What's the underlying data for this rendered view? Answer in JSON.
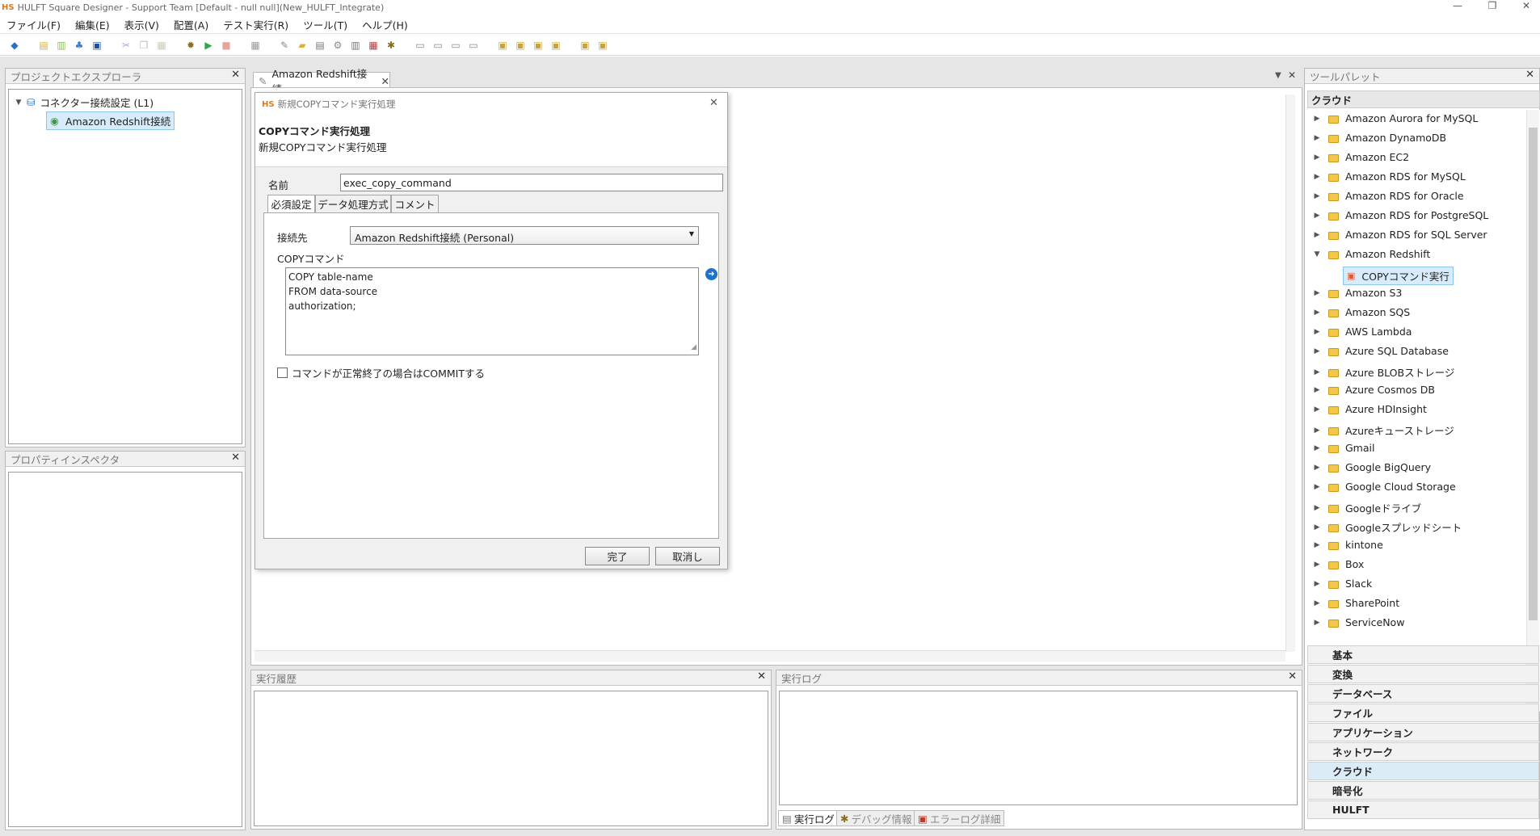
{
  "window": {
    "logo": "HS",
    "title": "HULFT Square Designer - Support Team [Default - null null](New_HULFT_Integrate)",
    "minimize": "—",
    "restore": "❐",
    "close": "✕"
  },
  "menu": [
    "ファイル(F)",
    "編集(E)",
    "表示(V)",
    "配置(A)",
    "テスト実行(R)",
    "ツール(T)",
    "ヘルプ(H)"
  ],
  "project_explorer": {
    "title": "プロジェクトエクスプローラ",
    "root": "コネクター接続設定 (L1)",
    "child": "Amazon Redshift接続"
  },
  "property_inspector": {
    "title": "プロパティインスペクタ"
  },
  "editor": {
    "tab_label": "Amazon Redshift接続"
  },
  "dialog": {
    "logo": "HS",
    "title": "新規COPYコマンド実行処理",
    "heading": "COPYコマンド実行処理",
    "subheading": "新規COPYコマンド実行処理",
    "name_label": "名前",
    "name_value": "exec_copy_command",
    "tabs": [
      "必須設定",
      "データ処理方式",
      "コメント"
    ],
    "connection_label": "接続先",
    "connection_value": "Amazon Redshift接続 (Personal)",
    "command_label": "COPYコマンド",
    "command_lines": [
      "COPY table-name",
      "FROM data-source",
      "authorization;"
    ],
    "commit_label": "コマンドが正常終了の場合はCOMMITする",
    "commit_checked": false,
    "ok_button": "完了",
    "cancel_button": "取消し"
  },
  "exec_history": {
    "title": "実行履歴"
  },
  "exec_log": {
    "title": "実行ログ",
    "tabs": [
      "実行ログ",
      "デバッグ情報",
      "エラーログ詳細"
    ]
  },
  "tool_palette": {
    "title": "ツールパレット",
    "section": "クラウド",
    "items": [
      "Amazon Aurora for MySQL",
      "Amazon DynamoDB",
      "Amazon EC2",
      "Amazon RDS for MySQL",
      "Amazon RDS for Oracle",
      "Amazon RDS for PostgreSQL",
      "Amazon RDS for SQL Server",
      "Amazon Redshift",
      "Amazon S3",
      "Amazon SQS",
      "AWS Lambda",
      "Azure SQL Database",
      "Azure BLOBストレージ",
      "Azure Cosmos DB",
      "Azure HDInsight",
      "Azureキューストレージ",
      "Gmail",
      "Google BigQuery",
      "Google Cloud Storage",
      "Googleドライブ",
      "Googleスプレッドシート",
      "kintone",
      "Box",
      "Slack",
      "SharePoint",
      "ServiceNow"
    ],
    "redshift_child": "COPYコマンド実行",
    "categories": [
      "基本",
      "変換",
      "データベース",
      "ファイル",
      "アプリケーション",
      "ネットワーク",
      "クラウド",
      "暗号化",
      "HULFT"
    ]
  }
}
